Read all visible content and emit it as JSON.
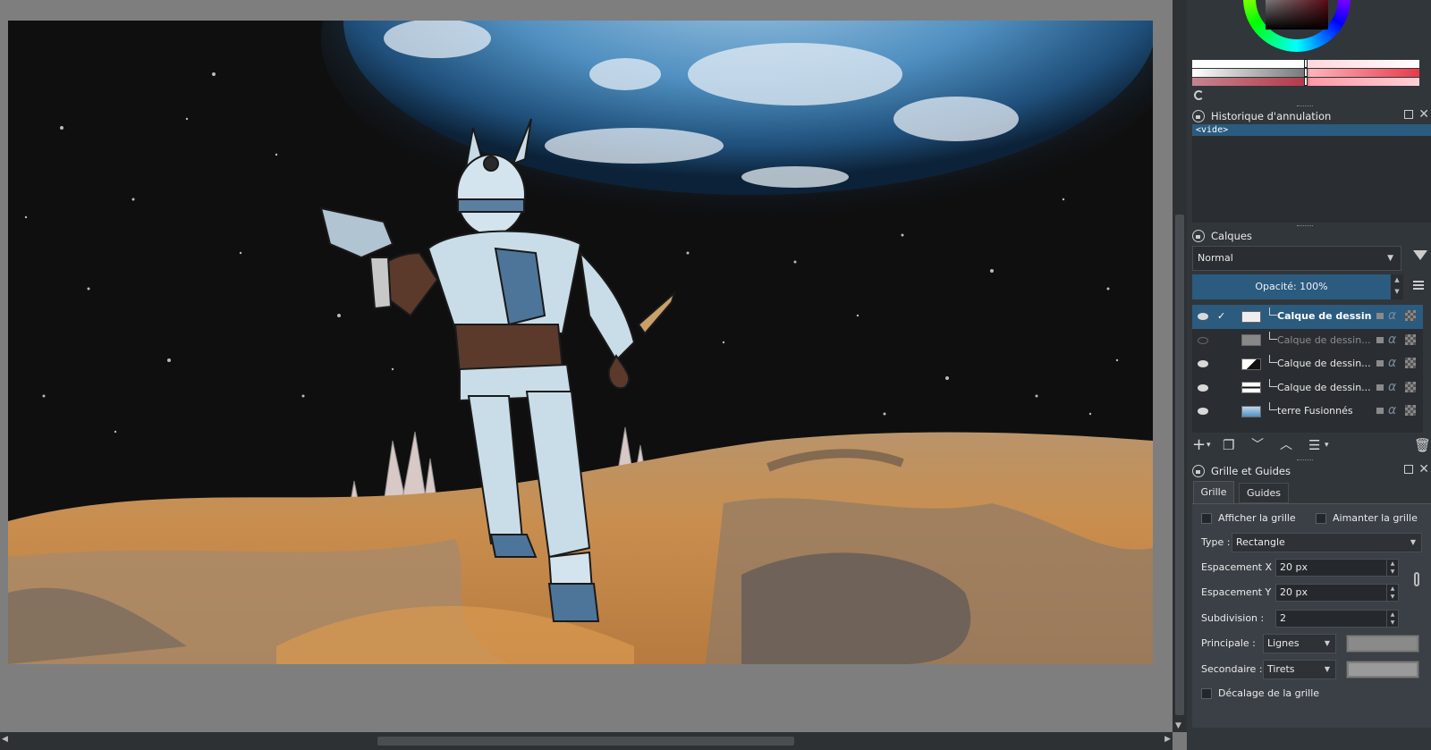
{
  "color_selector": {
    "accent": "#c2162e"
  },
  "history": {
    "title": "Historique d'annulation",
    "items": [
      "<vide>"
    ]
  },
  "layers": {
    "title": "Calques",
    "blend_mode": "Normal",
    "opacity_label": "Opacité:  100%",
    "items": [
      {
        "name": "Calque de dessin...",
        "visible": true,
        "selected": true
      },
      {
        "name": "Calque de dessin...",
        "visible": false,
        "selected": false
      },
      {
        "name": "Calque de dessin...",
        "visible": true,
        "selected": false
      },
      {
        "name": "Calque de dessin...",
        "visible": true,
        "selected": false
      },
      {
        "name": "terre Fusionnés",
        "visible": true,
        "selected": false
      }
    ]
  },
  "grid_guides": {
    "title": "Grille et Guides",
    "tabs": [
      "Grille",
      "Guides"
    ],
    "show_grid_label": "Afficher la grille",
    "snap_grid_label": "Aimanter la grille",
    "type_label": "Type :",
    "type_value": "Rectangle",
    "spacing_x_label": "Espacement X :",
    "spacing_x_value": "20 px",
    "spacing_y_label": "Espacement Y :",
    "spacing_y_value": "20 px",
    "subdivision_label": "Subdivision :",
    "subdivision_value": "2",
    "main_label": "Principale :",
    "main_style": "Lignes",
    "secondary_label": "Secondaire :",
    "secondary_style": "Tirets",
    "offset_label": "Décalage de la grille"
  },
  "colors": {
    "dock_bg": "#31363b",
    "selection": "#2b5b7f",
    "canvas_bg": "#7e7e7e"
  }
}
